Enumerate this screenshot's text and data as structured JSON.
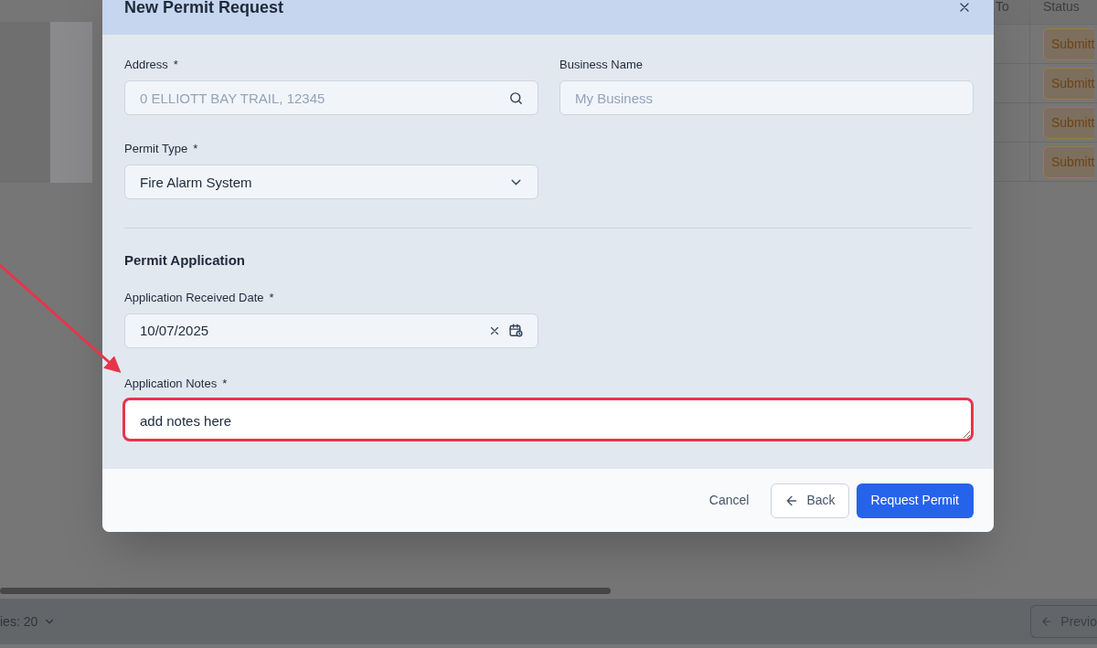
{
  "background_table": {
    "columns": [
      "To",
      "Status"
    ],
    "rows": [
      {
        "status": "Submitt"
      },
      {
        "status": "Submitt"
      },
      {
        "status": "Submitt"
      },
      {
        "status": "Submitt"
      }
    ]
  },
  "background_footer": {
    "page_size": "ies: 20",
    "previous_button": "Previo"
  },
  "modal": {
    "title": "New Permit Request",
    "fields_top": [
      {
        "label": "Address",
        "required_mark": "*",
        "placeholder": "0 ELLIOTT BAY TRAIL, 12345",
        "kind": "search"
      },
      {
        "label": "Business Name",
        "placeholder": "My Business",
        "kind": "text"
      }
    ],
    "permit_type": {
      "label": "Permit Type",
      "required_mark": "*",
      "value": "Fire Alarm System",
      "kind": "select"
    },
    "section_title": "Permit Application",
    "date_field": {
      "label": "Application Received Date",
      "required_mark": "*",
      "value": "10/07/2025",
      "kind": "date"
    },
    "notes_field": {
      "label": "Application Notes",
      "required_mark": "*",
      "value": "add notes here",
      "highlighted": true,
      "kind": "textarea"
    },
    "buttons": [
      {
        "label": "Cancel",
        "kind": "link"
      },
      {
        "label": "Back",
        "kind": "back"
      },
      {
        "label": "Request Permit",
        "kind": "primary"
      }
    ]
  }
}
